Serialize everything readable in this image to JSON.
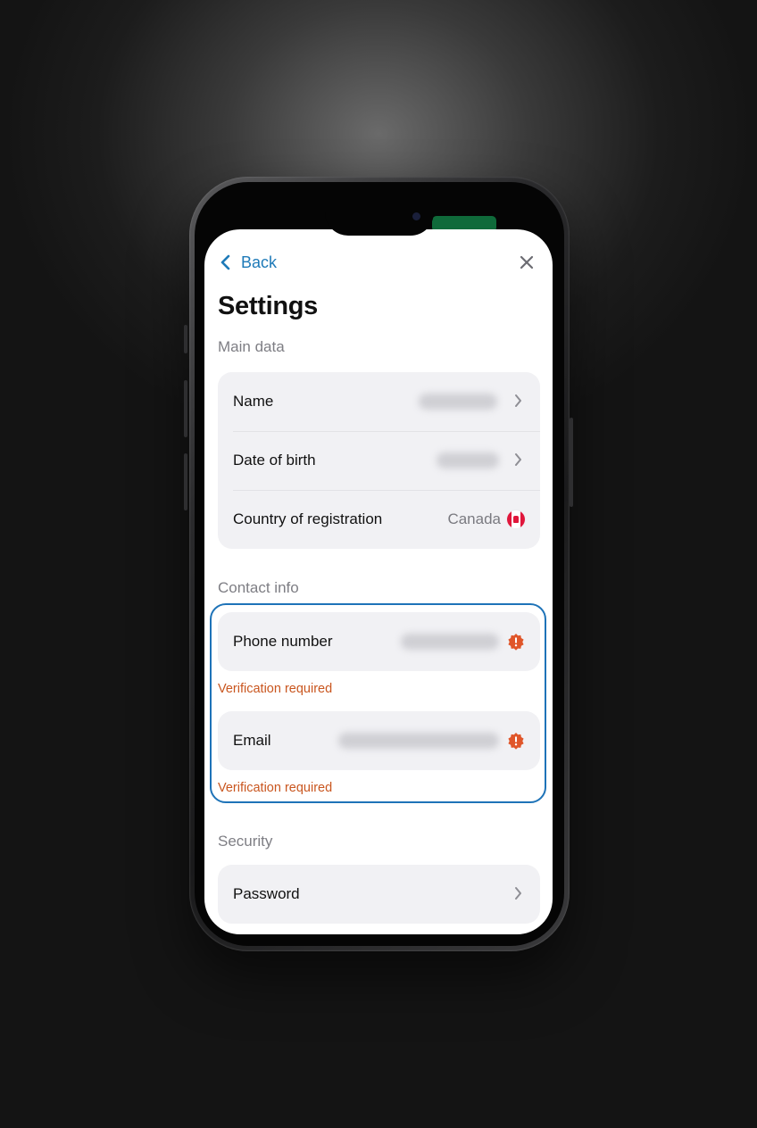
{
  "nav": {
    "back_label": "Back"
  },
  "page": {
    "title": "Settings"
  },
  "sections": {
    "main_data": {
      "label": "Main data",
      "rows": {
        "name": {
          "label": "Name"
        },
        "date_of_birth": {
          "label": "Date of birth"
        },
        "country": {
          "label": "Country of registration",
          "value": "Canada",
          "flag_icon": "canada-flag-icon"
        }
      }
    },
    "contact_info": {
      "label": "Contact info",
      "phone": {
        "label": "Phone number",
        "warning": "Verification required"
      },
      "email": {
        "label": "Email",
        "warning": "Verification required"
      }
    },
    "security": {
      "label": "Security",
      "password": {
        "label": "Password"
      }
    }
  },
  "colors": {
    "accent": "#1e7ab8",
    "warning": "#c9561f",
    "alert_badge": "#e0562a",
    "highlight_border": "#1e73b8",
    "card_bg": "#f1f1f4"
  },
  "icons": {
    "back": "chevron-left-icon",
    "close": "close-icon",
    "row_disclosure": "chevron-right-icon",
    "alert": "alert-badge-icon"
  }
}
